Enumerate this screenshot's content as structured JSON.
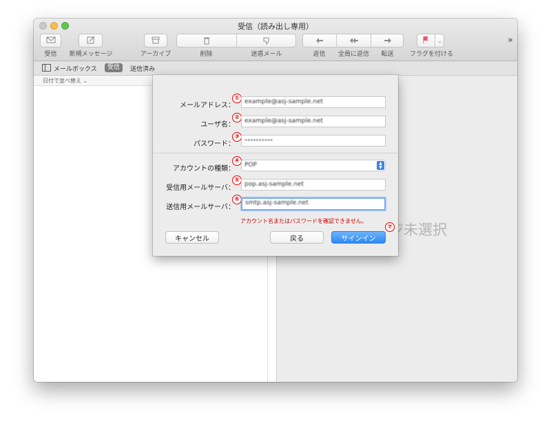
{
  "window": {
    "title": "受信（読み出し専用）"
  },
  "toolbar": {
    "get_mail": "受信",
    "new_message": "新規メッセージ",
    "archive": "アーカイブ",
    "delete": "削除",
    "junk": "迷惑メール",
    "reply": "返信",
    "reply_all": "全員に返信",
    "forward": "転送",
    "flag": "フラグを付ける",
    "overflow": "»"
  },
  "favorites": {
    "mailboxes": "メールボックス",
    "inbox": "受信",
    "sent": "送信済み"
  },
  "list": {
    "sort_label": "日付で並べ替え ⌄"
  },
  "viewer": {
    "no_message": "ジ未選択"
  },
  "dialog": {
    "email_label": "メールアドレス：",
    "email_value": "example@asj-sample.net",
    "username_label": "ユーザ名：",
    "username_value": "example@asj-sample.net",
    "password_label": "パスワード：",
    "password_value": "••••••••••",
    "account_type_label": "アカウントの種類：",
    "account_type_value": "POP",
    "incoming_label": "受信用メールサーバ：",
    "incoming_value": "pop.asj-sample.net",
    "outgoing_label": "送信用メールサーバ：",
    "outgoing_value": "smtp.asj-sample.net",
    "error": "アカウント名またはパスワードを確認できません。",
    "cancel": "キャンセル",
    "back": "戻る",
    "signin": "サインイン"
  },
  "markers": [
    "①",
    "②",
    "③",
    "④",
    "⑤",
    "⑥",
    "⑦"
  ],
  "colors": {
    "accent": "#2f8af5",
    "marker": "#e00000",
    "error": "#d00000"
  }
}
